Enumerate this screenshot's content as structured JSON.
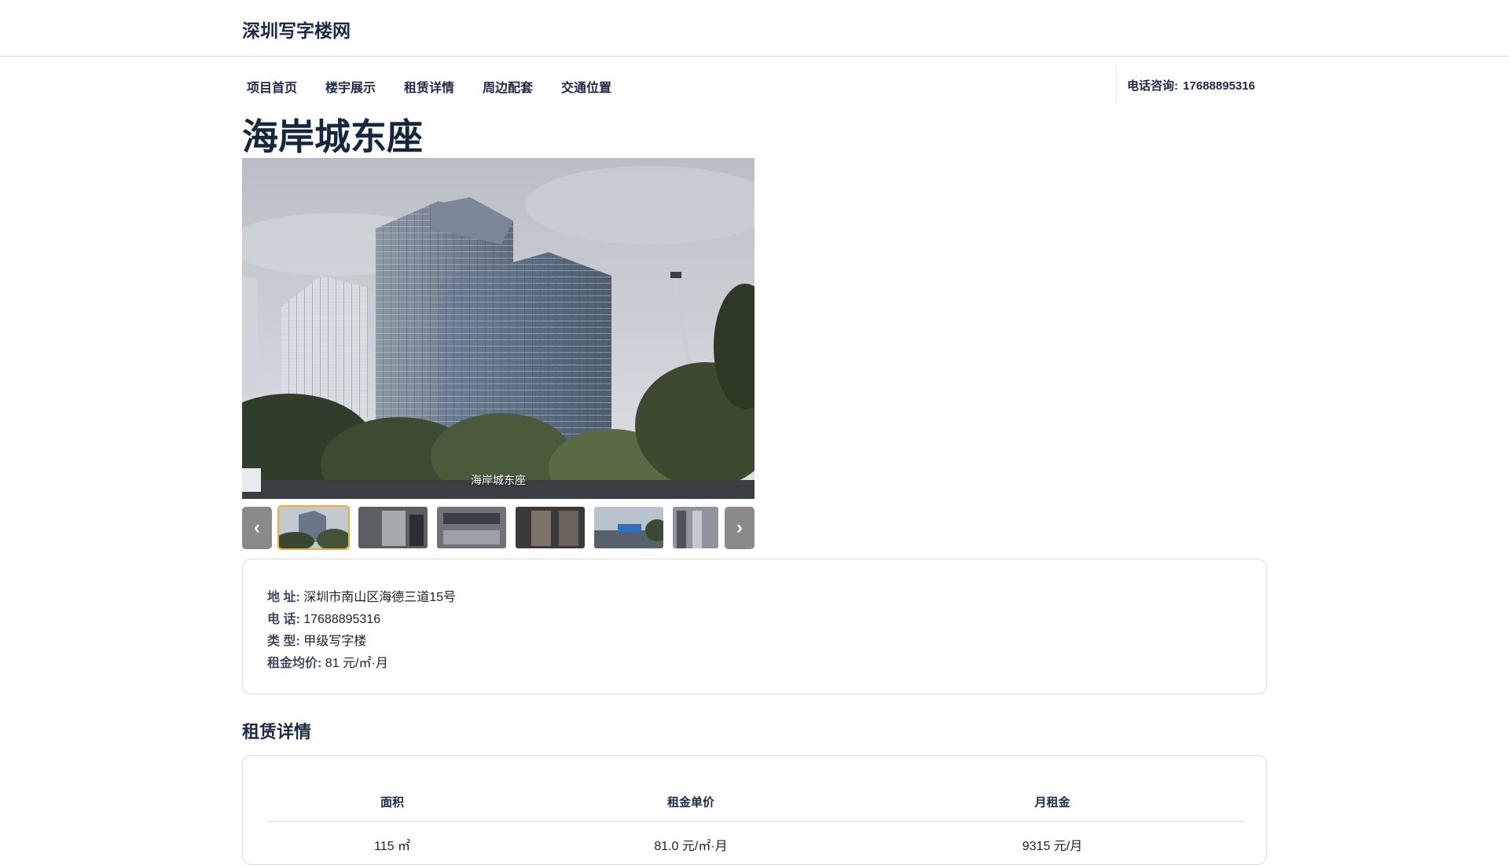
{
  "site": {
    "brand": "深圳写字楼网"
  },
  "nav": {
    "items": [
      {
        "label": "项目首页"
      },
      {
        "label": "楼宇展示"
      },
      {
        "label": "租赁详情"
      },
      {
        "label": "周边配套"
      },
      {
        "label": "交通位置"
      }
    ],
    "phone_label": "电话咨询:",
    "phone_number": "17688895316"
  },
  "page": {
    "title": "海岸城东座"
  },
  "gallery": {
    "caption": "海岸城东座",
    "prev_icon": "‹",
    "next_icon": "›",
    "active_index": 0,
    "thumb_count": 6
  },
  "info": {
    "address_label": "地 址:",
    "address": "深圳市南山区海德三道15号",
    "phone_label": "电 话:",
    "phone": "17688895316",
    "type_label": "类 型:",
    "type": "甲级写字楼",
    "rent_label": "租金均价:",
    "rent": "81 元/㎡·月"
  },
  "rental": {
    "section_title": "租赁详情",
    "headers": [
      "面积",
      "租金单价",
      "月租金"
    ],
    "rows": [
      [
        "115 ㎡",
        "81.0 元/㎡·月",
        "9315 元/月"
      ]
    ]
  },
  "colors": {
    "brand_text": "#1b2b45",
    "active_thumb_border": "#e8b03a",
    "arrow_bg": "#8a8a8a"
  }
}
